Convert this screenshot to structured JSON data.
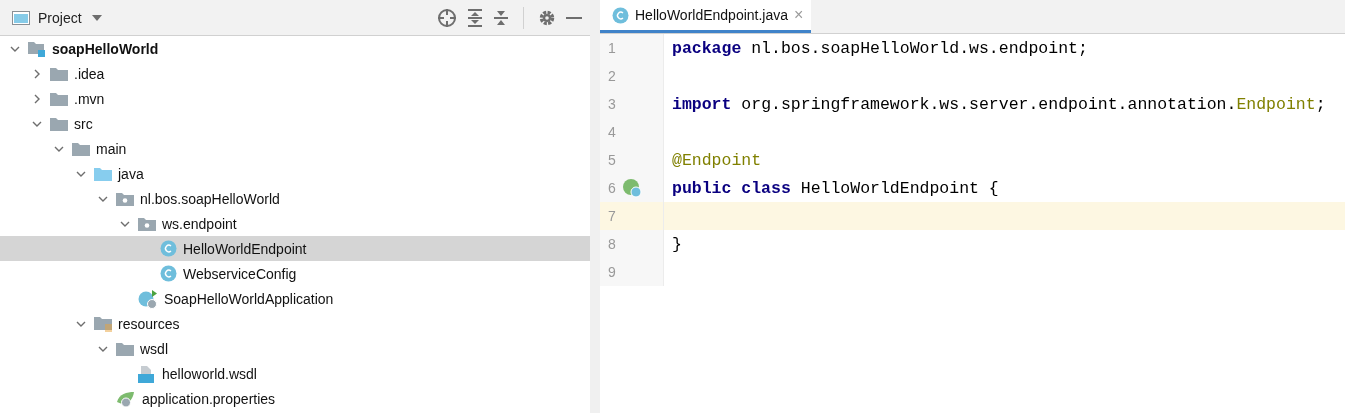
{
  "project_panel": {
    "title": "Project",
    "tree": [
      {
        "label": "soapHelloWorld",
        "kind": "module",
        "expanded": true,
        "selected": false,
        "children": [
          {
            "label": ".idea",
            "kind": "folder",
            "expanded": false,
            "selected": false
          },
          {
            "label": ".mvn",
            "kind": "folder",
            "expanded": false,
            "selected": false
          },
          {
            "label": "src",
            "kind": "folder",
            "expanded": true,
            "selected": false,
            "children": [
              {
                "label": "main",
                "kind": "folder",
                "expanded": true,
                "selected": false,
                "children": [
                  {
                    "label": "java",
                    "kind": "source-folder",
                    "expanded": true,
                    "selected": false,
                    "children": [
                      {
                        "label": "nl.bos.soapHelloWorld",
                        "kind": "package",
                        "expanded": true,
                        "selected": false,
                        "children": [
                          {
                            "label": "ws.endpoint",
                            "kind": "package",
                            "expanded": true,
                            "selected": false,
                            "children": [
                              {
                                "label": "HelloWorldEndpoint",
                                "kind": "class",
                                "selected": true
                              },
                              {
                                "label": "WebserviceConfig",
                                "kind": "class",
                                "selected": false
                              }
                            ]
                          },
                          {
                            "label": "SoapHelloWorldApplication",
                            "kind": "spring-app",
                            "selected": false
                          }
                        ]
                      }
                    ]
                  },
                  {
                    "label": "resources",
                    "kind": "resources",
                    "expanded": true,
                    "selected": false,
                    "children": [
                      {
                        "label": "wsdl",
                        "kind": "folder",
                        "expanded": true,
                        "selected": false,
                        "children": [
                          {
                            "label": "helloworld.wsdl",
                            "kind": "wsdl",
                            "selected": false
                          }
                        ]
                      },
                      {
                        "label": "application.properties",
                        "kind": "properties",
                        "selected": false
                      }
                    ]
                  }
                ]
              }
            ]
          }
        ]
      }
    ]
  },
  "editor": {
    "tabs": [
      {
        "label": "HelloWorldEndpoint.java",
        "selected": true,
        "close": "×"
      }
    ],
    "lines": [
      {
        "number": "1",
        "current": false,
        "tokens": [
          {
            "kind": "keyword",
            "text": "package"
          },
          {
            "kind": "plain",
            "text": " nl.bos.soapHelloWorld.ws.endpoint;"
          }
        ]
      },
      {
        "number": "2",
        "current": false
      },
      {
        "number": "3",
        "current": false,
        "tokens": [
          {
            "kind": "keyword",
            "text": "import"
          },
          {
            "kind": "plain",
            "text": " org.springframework.ws.server.endpoint.annotation."
          },
          {
            "kind": "annotation",
            "text": "Endpoint"
          },
          {
            "kind": "plain",
            "text": ";"
          }
        ]
      },
      {
        "number": "4",
        "current": false
      },
      {
        "number": "5",
        "current": false,
        "tokens": [
          {
            "kind": "annotation",
            "text": "@Endpoint"
          }
        ]
      },
      {
        "number": "6",
        "current": false,
        "gutter_icon": true,
        "tokens": [
          {
            "kind": "keyword",
            "text": "public class"
          },
          {
            "kind": "plain",
            "text": " HelloWorldEndpoint {"
          }
        ]
      },
      {
        "number": "7",
        "current": true
      },
      {
        "number": "8",
        "current": false,
        "tokens": [
          {
            "kind": "plain",
            "text": "}"
          }
        ]
      },
      {
        "number": "9",
        "current": false
      }
    ]
  }
}
